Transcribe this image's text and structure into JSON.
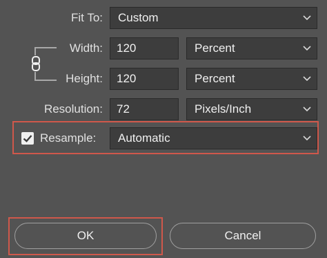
{
  "fit_to": {
    "label": "Fit To:",
    "value": "Custom"
  },
  "width": {
    "label": "Width:",
    "value": "120",
    "unit": "Percent"
  },
  "height": {
    "label": "Height:",
    "value": "120",
    "unit": "Percent"
  },
  "resolution": {
    "label": "Resolution:",
    "value": "72",
    "unit": "Pixels/Inch"
  },
  "resample": {
    "label": "Resample:",
    "checked": true,
    "value": "Automatic"
  },
  "buttons": {
    "ok": "OK",
    "cancel": "Cancel"
  },
  "colors": {
    "highlight": "#d0584b",
    "background": "#535353",
    "field": "#3d3d3d"
  },
  "icons": {
    "link": "chain-link-icon",
    "check": "checkmark-icon",
    "chevron": "chevron-down-icon"
  }
}
